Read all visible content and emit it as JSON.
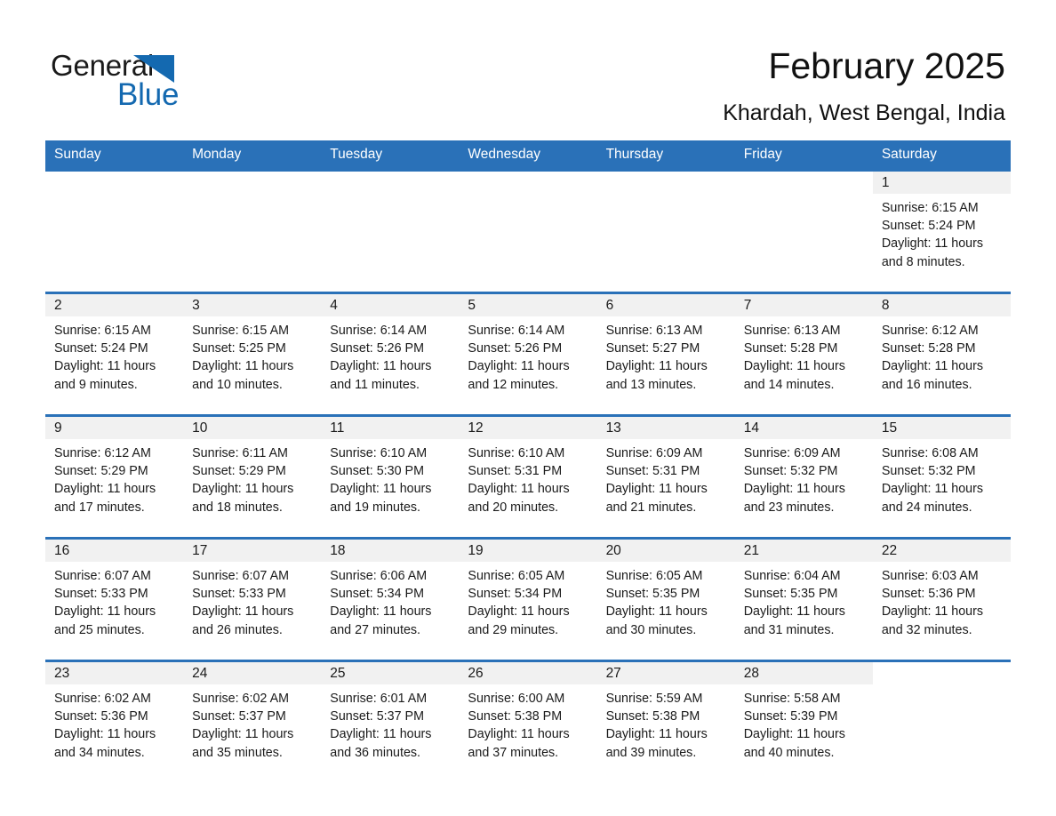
{
  "brand": {
    "name_part1": "General",
    "name_part2": "Blue",
    "logo_icon": "triangle-logo-icon",
    "accent_color": "#1469b0"
  },
  "header": {
    "title": "February 2025",
    "subtitle": "Khardah, West Bengal, India",
    "header_bar_color": "#2a71b8",
    "daynum_band_color": "#f1f1f1"
  },
  "weekday_headers": [
    "Sunday",
    "Monday",
    "Tuesday",
    "Wednesday",
    "Thursday",
    "Friday",
    "Saturday"
  ],
  "weeks": [
    [
      {
        "day": "",
        "sunrise": "",
        "sunset": "",
        "daylight1": "",
        "daylight2": "",
        "blank": true
      },
      {
        "day": "",
        "sunrise": "",
        "sunset": "",
        "daylight1": "",
        "daylight2": "",
        "blank": true
      },
      {
        "day": "",
        "sunrise": "",
        "sunset": "",
        "daylight1": "",
        "daylight2": "",
        "blank": true
      },
      {
        "day": "",
        "sunrise": "",
        "sunset": "",
        "daylight1": "",
        "daylight2": "",
        "blank": true
      },
      {
        "day": "",
        "sunrise": "",
        "sunset": "",
        "daylight1": "",
        "daylight2": "",
        "blank": true
      },
      {
        "day": "",
        "sunrise": "",
        "sunset": "",
        "daylight1": "",
        "daylight2": "",
        "blank": true
      },
      {
        "day": "1",
        "sunrise": "Sunrise: 6:15 AM",
        "sunset": "Sunset: 5:24 PM",
        "daylight1": "Daylight: 11 hours",
        "daylight2": "and 8 minutes.",
        "blank": false
      }
    ],
    [
      {
        "day": "2",
        "sunrise": "Sunrise: 6:15 AM",
        "sunset": "Sunset: 5:24 PM",
        "daylight1": "Daylight: 11 hours",
        "daylight2": "and 9 minutes.",
        "blank": false
      },
      {
        "day": "3",
        "sunrise": "Sunrise: 6:15 AM",
        "sunset": "Sunset: 5:25 PM",
        "daylight1": "Daylight: 11 hours",
        "daylight2": "and 10 minutes.",
        "blank": false
      },
      {
        "day": "4",
        "sunrise": "Sunrise: 6:14 AM",
        "sunset": "Sunset: 5:26 PM",
        "daylight1": "Daylight: 11 hours",
        "daylight2": "and 11 minutes.",
        "blank": false
      },
      {
        "day": "5",
        "sunrise": "Sunrise: 6:14 AM",
        "sunset": "Sunset: 5:26 PM",
        "daylight1": "Daylight: 11 hours",
        "daylight2": "and 12 minutes.",
        "blank": false
      },
      {
        "day": "6",
        "sunrise": "Sunrise: 6:13 AM",
        "sunset": "Sunset: 5:27 PM",
        "daylight1": "Daylight: 11 hours",
        "daylight2": "and 13 minutes.",
        "blank": false
      },
      {
        "day": "7",
        "sunrise": "Sunrise: 6:13 AM",
        "sunset": "Sunset: 5:28 PM",
        "daylight1": "Daylight: 11 hours",
        "daylight2": "and 14 minutes.",
        "blank": false
      },
      {
        "day": "8",
        "sunrise": "Sunrise: 6:12 AM",
        "sunset": "Sunset: 5:28 PM",
        "daylight1": "Daylight: 11 hours",
        "daylight2": "and 16 minutes.",
        "blank": false
      }
    ],
    [
      {
        "day": "9",
        "sunrise": "Sunrise: 6:12 AM",
        "sunset": "Sunset: 5:29 PM",
        "daylight1": "Daylight: 11 hours",
        "daylight2": "and 17 minutes.",
        "blank": false
      },
      {
        "day": "10",
        "sunrise": "Sunrise: 6:11 AM",
        "sunset": "Sunset: 5:29 PM",
        "daylight1": "Daylight: 11 hours",
        "daylight2": "and 18 minutes.",
        "blank": false
      },
      {
        "day": "11",
        "sunrise": "Sunrise: 6:10 AM",
        "sunset": "Sunset: 5:30 PM",
        "daylight1": "Daylight: 11 hours",
        "daylight2": "and 19 minutes.",
        "blank": false
      },
      {
        "day": "12",
        "sunrise": "Sunrise: 6:10 AM",
        "sunset": "Sunset: 5:31 PM",
        "daylight1": "Daylight: 11 hours",
        "daylight2": "and 20 minutes.",
        "blank": false
      },
      {
        "day": "13",
        "sunrise": "Sunrise: 6:09 AM",
        "sunset": "Sunset: 5:31 PM",
        "daylight1": "Daylight: 11 hours",
        "daylight2": "and 21 minutes.",
        "blank": false
      },
      {
        "day": "14",
        "sunrise": "Sunrise: 6:09 AM",
        "sunset": "Sunset: 5:32 PM",
        "daylight1": "Daylight: 11 hours",
        "daylight2": "and 23 minutes.",
        "blank": false
      },
      {
        "day": "15",
        "sunrise": "Sunrise: 6:08 AM",
        "sunset": "Sunset: 5:32 PM",
        "daylight1": "Daylight: 11 hours",
        "daylight2": "and 24 minutes.",
        "blank": false
      }
    ],
    [
      {
        "day": "16",
        "sunrise": "Sunrise: 6:07 AM",
        "sunset": "Sunset: 5:33 PM",
        "daylight1": "Daylight: 11 hours",
        "daylight2": "and 25 minutes.",
        "blank": false
      },
      {
        "day": "17",
        "sunrise": "Sunrise: 6:07 AM",
        "sunset": "Sunset: 5:33 PM",
        "daylight1": "Daylight: 11 hours",
        "daylight2": "and 26 minutes.",
        "blank": false
      },
      {
        "day": "18",
        "sunrise": "Sunrise: 6:06 AM",
        "sunset": "Sunset: 5:34 PM",
        "daylight1": "Daylight: 11 hours",
        "daylight2": "and 27 minutes.",
        "blank": false
      },
      {
        "day": "19",
        "sunrise": "Sunrise: 6:05 AM",
        "sunset": "Sunset: 5:34 PM",
        "daylight1": "Daylight: 11 hours",
        "daylight2": "and 29 minutes.",
        "blank": false
      },
      {
        "day": "20",
        "sunrise": "Sunrise: 6:05 AM",
        "sunset": "Sunset: 5:35 PM",
        "daylight1": "Daylight: 11 hours",
        "daylight2": "and 30 minutes.",
        "blank": false
      },
      {
        "day": "21",
        "sunrise": "Sunrise: 6:04 AM",
        "sunset": "Sunset: 5:35 PM",
        "daylight1": "Daylight: 11 hours",
        "daylight2": "and 31 minutes.",
        "blank": false
      },
      {
        "day": "22",
        "sunrise": "Sunrise: 6:03 AM",
        "sunset": "Sunset: 5:36 PM",
        "daylight1": "Daylight: 11 hours",
        "daylight2": "and 32 minutes.",
        "blank": false
      }
    ],
    [
      {
        "day": "23",
        "sunrise": "Sunrise: 6:02 AM",
        "sunset": "Sunset: 5:36 PM",
        "daylight1": "Daylight: 11 hours",
        "daylight2": "and 34 minutes.",
        "blank": false
      },
      {
        "day": "24",
        "sunrise": "Sunrise: 6:02 AM",
        "sunset": "Sunset: 5:37 PM",
        "daylight1": "Daylight: 11 hours",
        "daylight2": "and 35 minutes.",
        "blank": false
      },
      {
        "day": "25",
        "sunrise": "Sunrise: 6:01 AM",
        "sunset": "Sunset: 5:37 PM",
        "daylight1": "Daylight: 11 hours",
        "daylight2": "and 36 minutes.",
        "blank": false
      },
      {
        "day": "26",
        "sunrise": "Sunrise: 6:00 AM",
        "sunset": "Sunset: 5:38 PM",
        "daylight1": "Daylight: 11 hours",
        "daylight2": "and 37 minutes.",
        "blank": false
      },
      {
        "day": "27",
        "sunrise": "Sunrise: 5:59 AM",
        "sunset": "Sunset: 5:38 PM",
        "daylight1": "Daylight: 11 hours",
        "daylight2": "and 39 minutes.",
        "blank": false
      },
      {
        "day": "28",
        "sunrise": "Sunrise: 5:58 AM",
        "sunset": "Sunset: 5:39 PM",
        "daylight1": "Daylight: 11 hours",
        "daylight2": "and 40 minutes.",
        "blank": false
      },
      {
        "day": "",
        "sunrise": "",
        "sunset": "",
        "daylight1": "",
        "daylight2": "",
        "blank": true
      }
    ]
  ]
}
